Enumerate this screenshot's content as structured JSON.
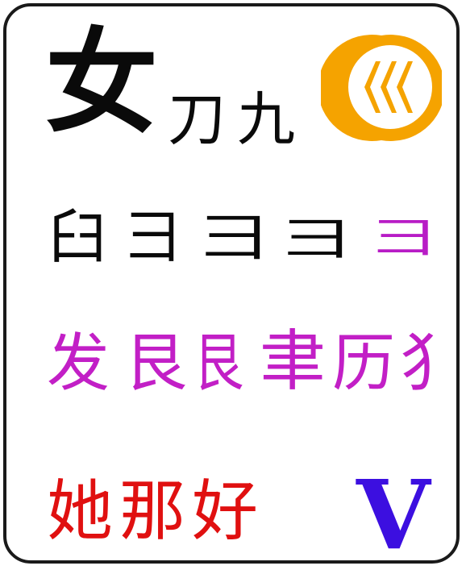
{
  "row1": {
    "big": "女",
    "small": [
      "刀",
      "九"
    ]
  },
  "emblem": {
    "icon": "wave-moon-icon",
    "ring_color": "#f5a300",
    "wave_color": "#f5a300"
  },
  "row2": {
    "chars": [
      "臼",
      "彐",
      "彐",
      "彐",
      "⺕"
    ],
    "colors": [
      "#0a0a0a",
      "#0a0a0a",
      "#0a0a0a",
      "#0a0a0a",
      "#b81cc6"
    ]
  },
  "row3": {
    "chars": [
      "发",
      "艮",
      "艮",
      "聿",
      "历",
      "犭"
    ],
    "color": "#c21fc6"
  },
  "row4": {
    "chars": [
      "她",
      "那",
      "好"
    ],
    "color": "#e01010",
    "latin": "V",
    "latin_color": "#3c0fe0"
  }
}
